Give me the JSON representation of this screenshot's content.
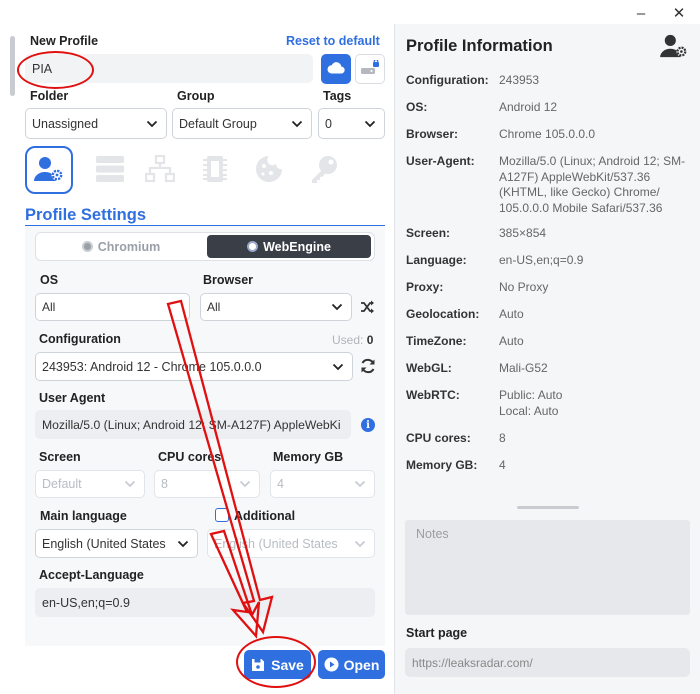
{
  "window": {
    "minimize_glyph": "–",
    "close_glyph": "✕"
  },
  "profile": {
    "new_profile_label": "New Profile",
    "reset_label": "Reset to default",
    "name_value": "PIA",
    "folder_label": "Folder",
    "folder_value": "Unassigned",
    "group_label": "Group",
    "group_value": "Default Group",
    "tags_label": "Tags",
    "tags_value": "0"
  },
  "tabs": [
    {
      "icon": "user-gear-icon",
      "active": true
    },
    {
      "icon": "server-icon",
      "active": false
    },
    {
      "icon": "network-icon",
      "active": false
    },
    {
      "icon": "chip-icon",
      "active": false
    },
    {
      "icon": "cookie-icon",
      "active": false
    },
    {
      "icon": "key-icon",
      "active": false
    }
  ],
  "settings": {
    "title": "Profile Settings",
    "engine_chromium": "Chromium",
    "engine_webengine": "WebEngine",
    "os_label": "OS",
    "os_value": "All",
    "browser_label": "Browser",
    "browser_value": "All",
    "configuration_label": "Configuration",
    "used_label": "Used:",
    "used_value": "0",
    "configuration_value": "243953: Android 12 - Chrome 105.0.0.0",
    "user_agent_label": "User Agent",
    "user_agent_value": "Mozilla/5.0 (Linux; Android 12; SM-A127F) AppleWebKi",
    "screen_label": "Screen",
    "screen_value": "Default",
    "cpu_label": "CPU cores",
    "cpu_value": "8",
    "memory_label": "Memory GB",
    "memory_value": "4",
    "main_language_label": "Main language",
    "main_language_value": "English (United States",
    "additional_label": "Additional",
    "additional_value": "English (United States",
    "accept_language_label": "Accept-Language",
    "accept_language_value": "en-US,en;q=0.9"
  },
  "buttons": {
    "save": "Save",
    "open": "Open"
  },
  "info": {
    "title": "Profile Information",
    "rows": [
      {
        "key": "Configuration:",
        "value": "243953"
      },
      {
        "key": "OS:",
        "value": "Android 12"
      },
      {
        "key": "Browser:",
        "value": "Chrome 105.0.0.0"
      },
      {
        "key": "User-Agent:",
        "value": "Mozilla/5.0 (Linux; Android 12; SM-A127F) AppleWebKit/537.36 (KHTML, like Gecko) Chrome/ 105.0.0.0 Mobile Safari/537.36"
      },
      {
        "key": "Screen:",
        "value": "385×854"
      },
      {
        "key": "Language:",
        "value": "en-US,en;q=0.9"
      },
      {
        "key": "Proxy:",
        "value": "No Proxy"
      },
      {
        "key": "Geolocation:",
        "value": "Auto"
      },
      {
        "key": "TimeZone:",
        "value": "Auto"
      },
      {
        "key": "WebGL:",
        "value": "Mali-G52"
      },
      {
        "key": "WebRTC:",
        "value": "Public: Auto\nLocal:  Auto"
      },
      {
        "key": "CPU cores:",
        "value": "8"
      },
      {
        "key": "Memory GB:",
        "value": "4"
      }
    ],
    "notes_placeholder": "Notes",
    "start_page_label": "Start page",
    "start_page_placeholder": "https://leaksradar.com/"
  },
  "colors": {
    "accent": "#2f6fe0",
    "annotation": "#e01010"
  }
}
